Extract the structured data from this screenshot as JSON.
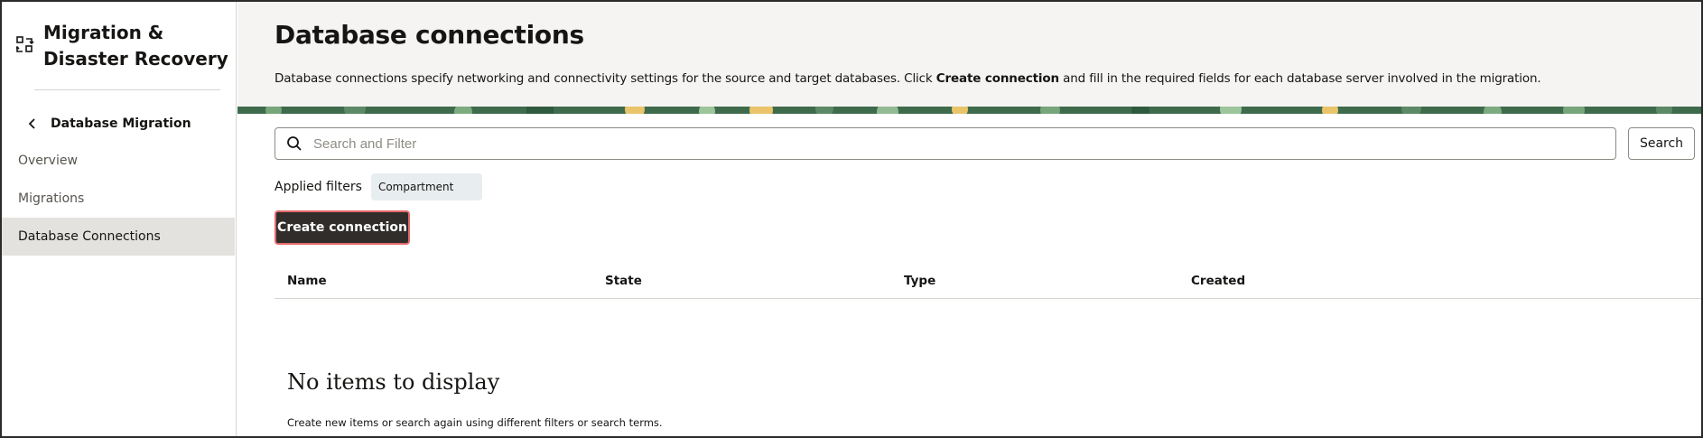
{
  "sidebar": {
    "app_title": "Migration & Disaster Recovery",
    "back_label": "Database Migration",
    "items": [
      {
        "label": "Overview",
        "active": false
      },
      {
        "label": "Migrations",
        "active": false
      },
      {
        "label": "Database Connections",
        "active": true
      }
    ]
  },
  "header": {
    "title": "Database connections",
    "description_before": "Database connections specify networking and connectivity settings for the source and target databases. Click ",
    "description_bold": "Create connection",
    "description_after": " and fill in the required fields for each database server involved in the migration."
  },
  "search": {
    "placeholder": "Search and Filter",
    "value": "",
    "button_label": "Search"
  },
  "filters": {
    "label": "Applied filters",
    "chips": [
      "Compartment"
    ]
  },
  "actions": {
    "create_label": "Create connection"
  },
  "table": {
    "columns": [
      "Name",
      "State",
      "Type",
      "Created"
    ],
    "rows": []
  },
  "empty_state": {
    "title": "No items to display",
    "description": "Create new items or search again using different filters or search terms."
  },
  "colors": {
    "primary_button": "#312d2a",
    "highlight_border": "#e06a6a",
    "active_nav": "#e4e2df",
    "header_bg": "#f6f4f2",
    "banner_green": "#3e6b4c",
    "banner_yellow": "#e9c46a"
  }
}
